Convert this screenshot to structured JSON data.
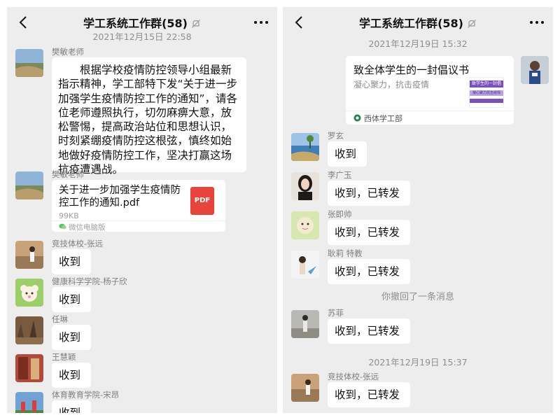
{
  "chat": {
    "title": "学工系统工作群",
    "member_count": "(58)",
    "icons": {
      "back": "chevron-left-icon",
      "mute": "bell-off-icon",
      "more": "more-dots-icon",
      "pdf": "pdf-file-icon",
      "wechat": "wechat-icon"
    }
  },
  "left": {
    "timestamp": "2021年12月15日 22:58",
    "messages": [
      {
        "sender": "樊敏老师",
        "text": "根据学校疫情防控领导小组最新指示精神，学工部特下发“关于进一步加强学生疫情防控工作的通知”，请各位老师遵照执行，切勿麻痹大意，放松警惕，提高政治站位和思想认识，时刻紧绷疫情防控这根弦，慎终如始地做好疫情防控工作，坚决打赢这场抗疫遭遇战。"
      },
      {
        "sender": "樊敏老师",
        "file_name": "关于进一步加强学生疫情防控工作的通知.pdf",
        "file_size": "99KB",
        "file_badge": "PDF",
        "file_source": "微信电脑版"
      },
      {
        "sender": "竞技体校-张远",
        "text": "收到"
      },
      {
        "sender": "健康科学学院-杨子欣",
        "text": "收到"
      },
      {
        "sender": "任琳",
        "text": "收到"
      },
      {
        "sender": "王慧颖",
        "text": "收到"
      },
      {
        "sender": "体育教育学院-宋昂",
        "text": "收到"
      }
    ]
  },
  "right": {
    "timestamp_1": "2021年12月19日 15:32",
    "link_card": {
      "title": "致全体学生的一封倡议书",
      "desc": "凝心聚力，抗击疫情",
      "thumb_title": "致学生的一封倡",
      "thumb_sub": "凝心聚力抗击疫情",
      "source": "西体学工部"
    },
    "messages": [
      {
        "sender": "罗玄",
        "text": "收到"
      },
      {
        "sender": "李广玉",
        "text": "收到，已转发"
      },
      {
        "sender": "张即帅",
        "text": "收到，已转发"
      },
      {
        "sender": "耿莉 特教",
        "text": "收到，已转发"
      }
    ],
    "recall_notice": "你撤回了一条消息",
    "messages_2": [
      {
        "sender": "苏菲",
        "text": "收到，已转发"
      }
    ],
    "timestamp_2": "2021年12月19日 15:37",
    "messages_3": [
      {
        "sender": "竞技体校-张远",
        "text": "收到，已转发"
      }
    ]
  },
  "colors": {
    "background": "#ededed",
    "bubble": "#ffffff",
    "pdf_red": "#e8443a",
    "thumb_purple": "#7a4fc3"
  }
}
